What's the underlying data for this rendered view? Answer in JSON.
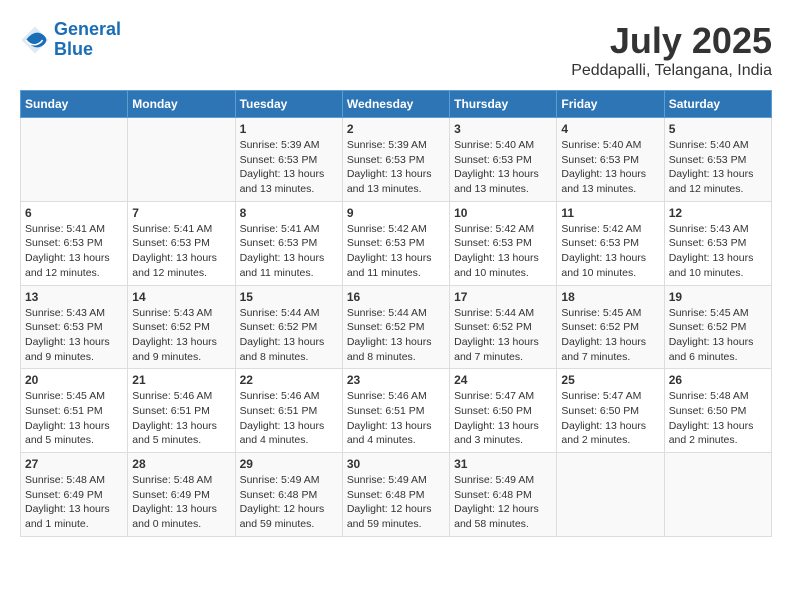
{
  "logo": {
    "line1": "General",
    "line2": "Blue"
  },
  "title": "July 2025",
  "location": "Peddapalli, Telangana, India",
  "headers": [
    "Sunday",
    "Monday",
    "Tuesday",
    "Wednesday",
    "Thursday",
    "Friday",
    "Saturday"
  ],
  "weeks": [
    [
      {
        "day": "",
        "sunrise": "",
        "sunset": "",
        "daylight": ""
      },
      {
        "day": "",
        "sunrise": "",
        "sunset": "",
        "daylight": ""
      },
      {
        "day": "1",
        "sunrise": "Sunrise: 5:39 AM",
        "sunset": "Sunset: 6:53 PM",
        "daylight": "Daylight: 13 hours and 13 minutes."
      },
      {
        "day": "2",
        "sunrise": "Sunrise: 5:39 AM",
        "sunset": "Sunset: 6:53 PM",
        "daylight": "Daylight: 13 hours and 13 minutes."
      },
      {
        "day": "3",
        "sunrise": "Sunrise: 5:40 AM",
        "sunset": "Sunset: 6:53 PM",
        "daylight": "Daylight: 13 hours and 13 minutes."
      },
      {
        "day": "4",
        "sunrise": "Sunrise: 5:40 AM",
        "sunset": "Sunset: 6:53 PM",
        "daylight": "Daylight: 13 hours and 13 minutes."
      },
      {
        "day": "5",
        "sunrise": "Sunrise: 5:40 AM",
        "sunset": "Sunset: 6:53 PM",
        "daylight": "Daylight: 13 hours and 12 minutes."
      }
    ],
    [
      {
        "day": "6",
        "sunrise": "Sunrise: 5:41 AM",
        "sunset": "Sunset: 6:53 PM",
        "daylight": "Daylight: 13 hours and 12 minutes."
      },
      {
        "day": "7",
        "sunrise": "Sunrise: 5:41 AM",
        "sunset": "Sunset: 6:53 PM",
        "daylight": "Daylight: 13 hours and 12 minutes."
      },
      {
        "day": "8",
        "sunrise": "Sunrise: 5:41 AM",
        "sunset": "Sunset: 6:53 PM",
        "daylight": "Daylight: 13 hours and 11 minutes."
      },
      {
        "day": "9",
        "sunrise": "Sunrise: 5:42 AM",
        "sunset": "Sunset: 6:53 PM",
        "daylight": "Daylight: 13 hours and 11 minutes."
      },
      {
        "day": "10",
        "sunrise": "Sunrise: 5:42 AM",
        "sunset": "Sunset: 6:53 PM",
        "daylight": "Daylight: 13 hours and 10 minutes."
      },
      {
        "day": "11",
        "sunrise": "Sunrise: 5:42 AM",
        "sunset": "Sunset: 6:53 PM",
        "daylight": "Daylight: 13 hours and 10 minutes."
      },
      {
        "day": "12",
        "sunrise": "Sunrise: 5:43 AM",
        "sunset": "Sunset: 6:53 PM",
        "daylight": "Daylight: 13 hours and 10 minutes."
      }
    ],
    [
      {
        "day": "13",
        "sunrise": "Sunrise: 5:43 AM",
        "sunset": "Sunset: 6:53 PM",
        "daylight": "Daylight: 13 hours and 9 minutes."
      },
      {
        "day": "14",
        "sunrise": "Sunrise: 5:43 AM",
        "sunset": "Sunset: 6:52 PM",
        "daylight": "Daylight: 13 hours and 9 minutes."
      },
      {
        "day": "15",
        "sunrise": "Sunrise: 5:44 AM",
        "sunset": "Sunset: 6:52 PM",
        "daylight": "Daylight: 13 hours and 8 minutes."
      },
      {
        "day": "16",
        "sunrise": "Sunrise: 5:44 AM",
        "sunset": "Sunset: 6:52 PM",
        "daylight": "Daylight: 13 hours and 8 minutes."
      },
      {
        "day": "17",
        "sunrise": "Sunrise: 5:44 AM",
        "sunset": "Sunset: 6:52 PM",
        "daylight": "Daylight: 13 hours and 7 minutes."
      },
      {
        "day": "18",
        "sunrise": "Sunrise: 5:45 AM",
        "sunset": "Sunset: 6:52 PM",
        "daylight": "Daylight: 13 hours and 7 minutes."
      },
      {
        "day": "19",
        "sunrise": "Sunrise: 5:45 AM",
        "sunset": "Sunset: 6:52 PM",
        "daylight": "Daylight: 13 hours and 6 minutes."
      }
    ],
    [
      {
        "day": "20",
        "sunrise": "Sunrise: 5:45 AM",
        "sunset": "Sunset: 6:51 PM",
        "daylight": "Daylight: 13 hours and 5 minutes."
      },
      {
        "day": "21",
        "sunrise": "Sunrise: 5:46 AM",
        "sunset": "Sunset: 6:51 PM",
        "daylight": "Daylight: 13 hours and 5 minutes."
      },
      {
        "day": "22",
        "sunrise": "Sunrise: 5:46 AM",
        "sunset": "Sunset: 6:51 PM",
        "daylight": "Daylight: 13 hours and 4 minutes."
      },
      {
        "day": "23",
        "sunrise": "Sunrise: 5:46 AM",
        "sunset": "Sunset: 6:51 PM",
        "daylight": "Daylight: 13 hours and 4 minutes."
      },
      {
        "day": "24",
        "sunrise": "Sunrise: 5:47 AM",
        "sunset": "Sunset: 6:50 PM",
        "daylight": "Daylight: 13 hours and 3 minutes."
      },
      {
        "day": "25",
        "sunrise": "Sunrise: 5:47 AM",
        "sunset": "Sunset: 6:50 PM",
        "daylight": "Daylight: 13 hours and 2 minutes."
      },
      {
        "day": "26",
        "sunrise": "Sunrise: 5:48 AM",
        "sunset": "Sunset: 6:50 PM",
        "daylight": "Daylight: 13 hours and 2 minutes."
      }
    ],
    [
      {
        "day": "27",
        "sunrise": "Sunrise: 5:48 AM",
        "sunset": "Sunset: 6:49 PM",
        "daylight": "Daylight: 13 hours and 1 minute."
      },
      {
        "day": "28",
        "sunrise": "Sunrise: 5:48 AM",
        "sunset": "Sunset: 6:49 PM",
        "daylight": "Daylight: 13 hours and 0 minutes."
      },
      {
        "day": "29",
        "sunrise": "Sunrise: 5:49 AM",
        "sunset": "Sunset: 6:48 PM",
        "daylight": "Daylight: 12 hours and 59 minutes."
      },
      {
        "day": "30",
        "sunrise": "Sunrise: 5:49 AM",
        "sunset": "Sunset: 6:48 PM",
        "daylight": "Daylight: 12 hours and 59 minutes."
      },
      {
        "day": "31",
        "sunrise": "Sunrise: 5:49 AM",
        "sunset": "Sunset: 6:48 PM",
        "daylight": "Daylight: 12 hours and 58 minutes."
      },
      {
        "day": "",
        "sunrise": "",
        "sunset": "",
        "daylight": ""
      },
      {
        "day": "",
        "sunrise": "",
        "sunset": "",
        "daylight": ""
      }
    ]
  ]
}
